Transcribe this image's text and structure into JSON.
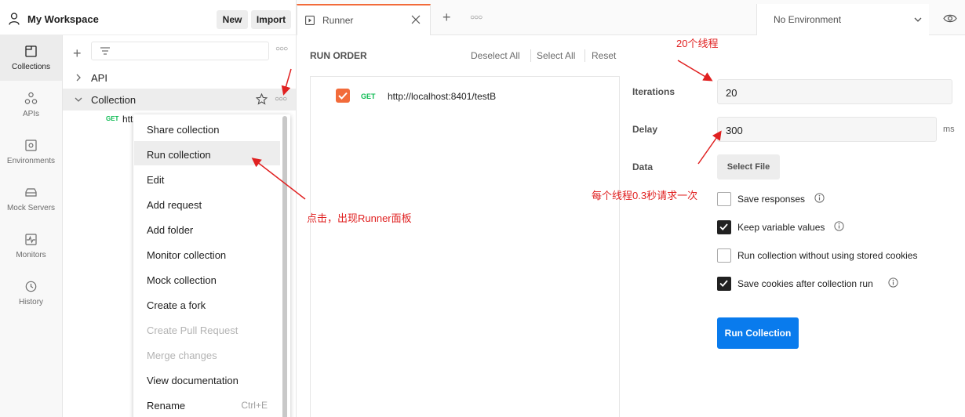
{
  "workspace": {
    "title": "My Workspace",
    "new_label": "New",
    "import_label": "Import"
  },
  "sidebar": {
    "items": [
      {
        "label": "Collections",
        "icon": "collections-icon"
      },
      {
        "label": "APIs",
        "icon": "apis-icon"
      },
      {
        "label": "Environments",
        "icon": "environments-icon"
      },
      {
        "label": "Mock Servers",
        "icon": "mock-servers-icon"
      },
      {
        "label": "Monitors",
        "icon": "monitors-icon"
      },
      {
        "label": "History",
        "icon": "history-icon"
      }
    ]
  },
  "tree": {
    "items": [
      {
        "label": "API"
      },
      {
        "label": "Collection"
      }
    ],
    "request": {
      "method": "GET",
      "url": "http://localhost:8401/testB"
    }
  },
  "context_menu": {
    "items": [
      {
        "label": "Share collection"
      },
      {
        "label": "Run collection"
      },
      {
        "label": "Edit"
      },
      {
        "label": "Add request"
      },
      {
        "label": "Add folder"
      },
      {
        "label": "Monitor collection"
      },
      {
        "label": "Mock collection"
      },
      {
        "label": "Create a fork"
      },
      {
        "label": "Create Pull Request"
      },
      {
        "label": "Merge changes"
      },
      {
        "label": "View documentation"
      },
      {
        "label": "Rename",
        "shortcut": "Ctrl+E"
      }
    ]
  },
  "tabs": {
    "runner_title": "Runner",
    "environment": "No Environment"
  },
  "runner": {
    "run_order": "RUN ORDER",
    "deselect_all": "Deselect All",
    "select_all": "Select All",
    "reset": "Reset",
    "request": {
      "method": "GET",
      "url": "http://localhost:8401/testB"
    },
    "iterations_label": "Iterations",
    "iterations_value": "20",
    "delay_label": "Delay",
    "delay_value": "300",
    "delay_unit": "ms",
    "data_label": "Data",
    "select_file": "Select File",
    "options": [
      {
        "label": "Save responses",
        "checked": false
      },
      {
        "label": "Keep variable values",
        "checked": true
      },
      {
        "label": "Run collection without using stored cookies",
        "checked": false
      },
      {
        "label": "Save cookies after collection run",
        "checked": true
      }
    ],
    "run_button": "Run Collection"
  },
  "annotations": {
    "threads": "20个线程",
    "click_hint": "点击，出现Runner面板",
    "delay_hint": "每个线程0.3秒请求一次",
    "color": "#e02020"
  },
  "colors": {
    "accent": "#f26b3a",
    "primary_button": "#097bed",
    "get_method": "#0cbb52"
  }
}
